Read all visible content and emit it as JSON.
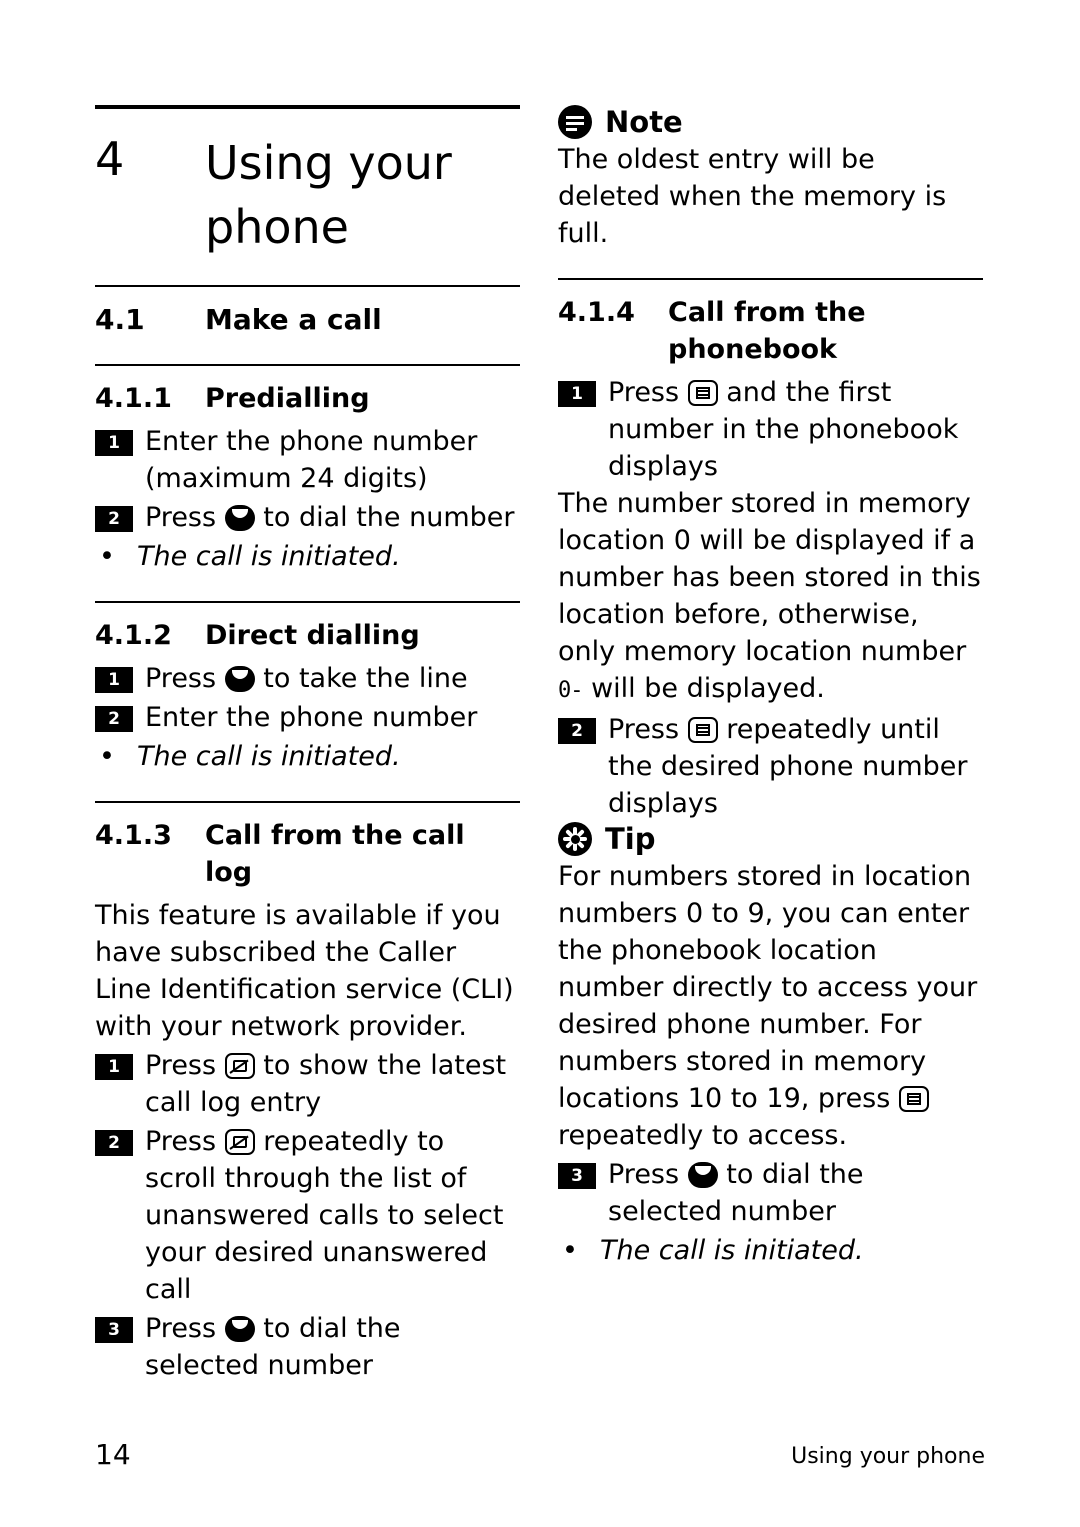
{
  "document": {
    "chapter_number": "4",
    "chapter_title": "Using your phone",
    "footer_page_number": "14",
    "footer_running_head": "Using your phone"
  },
  "left_column": {
    "section_41": {
      "number": "4.1",
      "title": "Make a call"
    },
    "section_411": {
      "number": "4.1.1",
      "title": "Predialling",
      "steps": [
        {
          "num": "1",
          "text": "Enter the phone number (maximum 24 digits)"
        },
        {
          "num": "2",
          "text_before": "Press",
          "icon": "talk-key-icon",
          "text_after": "to dial the number"
        }
      ],
      "bullet": "The call is initiated."
    },
    "section_412": {
      "number": "4.1.2",
      "title": "Direct dialling",
      "steps": [
        {
          "num": "1",
          "text_before": "Press",
          "icon": "talk-key-icon",
          "text_after": "to take the line"
        },
        {
          "num": "2",
          "text": "Enter the phone number"
        }
      ],
      "bullet": "The call is initiated."
    },
    "section_413": {
      "number": "4.1.3",
      "title": "Call from the call log",
      "intro": "This feature is available if you have subscribed the Caller Line Identification service (CLI) with your network provider.",
      "steps": [
        {
          "num": "1",
          "text_before": "Press",
          "icon": "call-log-key-icon",
          "text_after": "to show the latest call log entry"
        },
        {
          "num": "2",
          "text_before": "Press",
          "icon": "call-log-key-icon",
          "text_after": "repeatedly to scroll through the list of unanswered calls to select your desired unanswered call"
        },
        {
          "num": "3",
          "text_before": "Press",
          "icon": "talk-key-icon",
          "text_after": "to dial the selected number"
        }
      ]
    }
  },
  "right_column": {
    "note": {
      "icon": "note-icon",
      "title": "Note",
      "text": "The oldest entry will be deleted when the memory is full."
    },
    "section_414": {
      "number": "4.1.4",
      "title": "Call from the phonebook",
      "step1": {
        "num": "1",
        "text_before": "Press",
        "icon": "phonebook-key-icon",
        "text_after": "and the first number in the phonebook displays"
      },
      "paragraph_before_lcd": "The number stored in memory location 0 will be displayed if a number has been stored in this location before, otherwise, only memory location number",
      "lcd_value": "0-",
      "paragraph_after_lcd": "will be displayed.",
      "step2": {
        "num": "2",
        "text_before": "Press",
        "icon": "phonebook-key-icon",
        "text_after": "repeatedly until the desired phone number displays"
      }
    },
    "tip": {
      "icon": "tip-icon",
      "title": "Tip",
      "text_before_icon": "For numbers stored in location numbers 0 to 9, you can enter the phonebook location number directly to access your desired phone number. For numbers stored in memory locations 10 to 19, press",
      "inline_icon": "phonebook-key-icon",
      "text_after_icon": "repeatedly to access."
    },
    "final_step": {
      "num": "3",
      "text_before": "Press",
      "icon": "talk-key-icon",
      "text_after": "to dial the selected number"
    },
    "final_bullet": "The call is initiated."
  }
}
